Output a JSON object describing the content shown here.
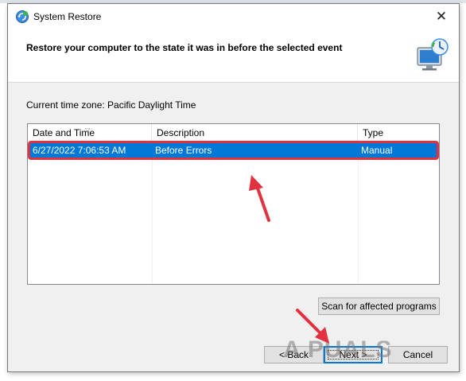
{
  "window": {
    "title": "System Restore",
    "close_glyph": "✕"
  },
  "header": {
    "text": "Restore your computer to the state it was in before the selected event"
  },
  "timezone_label": "Current time zone: Pacific Daylight Time",
  "table": {
    "columns": [
      "Date and Time",
      "Description",
      "Type"
    ],
    "rows": [
      {
        "date": "6/27/2022 7:06:53 AM",
        "description": "Before Errors",
        "type": "Manual",
        "selected": true
      }
    ]
  },
  "buttons": {
    "scan": "Scan for affected programs",
    "back": "< Back",
    "next": "Next >",
    "cancel": "Cancel"
  },
  "watermark": "A  PUALS",
  "colors": {
    "selection": "#0078d7",
    "annotation": "#e2313f"
  },
  "icons": [
    "system-restore-icon",
    "close-icon",
    "restore-monitor-icon",
    "sort-arrow-icon",
    "annotation-arrow-icon"
  ]
}
